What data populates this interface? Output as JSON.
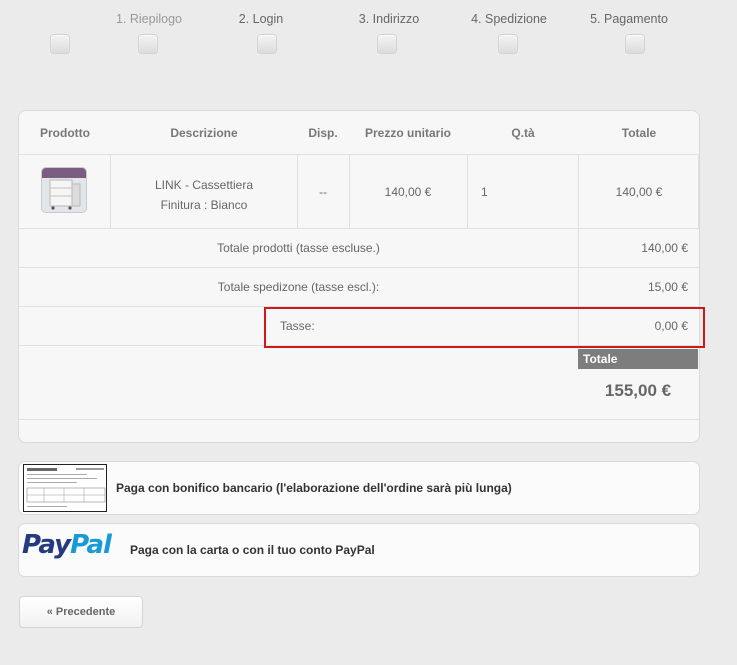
{
  "steps": [
    {
      "label": "1. Riepilogo"
    },
    {
      "label": "2. Login"
    },
    {
      "label": "3. Indirizzo"
    },
    {
      "label": "4. Spedizione"
    },
    {
      "label": "5. Pagamento"
    }
  ],
  "cart": {
    "headers": {
      "product": "Prodotto",
      "description": "Descrizione",
      "availability": "Disp.",
      "unit_price": "Prezzo unitario",
      "quantity": "Q.tà",
      "total": "Totale"
    },
    "item": {
      "name": "LINK - Cassettiera",
      "finish": "Finitura : Bianco",
      "availability": "--",
      "unit_price": "140,00 €",
      "quantity": "1",
      "total": "140,00 €"
    },
    "summary": {
      "products_label": "Totale prodotti (tasse escluse.)",
      "products_value": "140,00 €",
      "shipping_label": "Totale spedizone (tasse escl.):",
      "shipping_value": "15,00 €",
      "taxes_label": "Tasse:",
      "taxes_value": "0,00 €",
      "total_label": "Totale",
      "total_value": "155,00 €"
    }
  },
  "payment": {
    "bank_transfer_label": "Paga con bonifico bancario (l'elaborazione dell'ordine sarà più lunga)",
    "paypal_label": "Paga con la carta o con il tuo conto PayPal",
    "paypal_logo_a": "Pay",
    "paypal_logo_b": "Pal"
  },
  "nav": {
    "previous_label": "« Precedente"
  },
  "colors": {
    "highlight": "#cc1a1a",
    "total_header_bg": "#7d7d7d",
    "paypal_dark": "#253b80",
    "paypal_light": "#179bd7"
  }
}
